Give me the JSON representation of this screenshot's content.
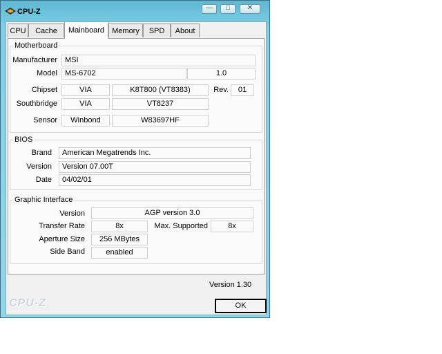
{
  "window": {
    "title": "CPU-Z",
    "minimize_icon": "minimize-icon",
    "maximize_icon": "maximize-icon",
    "close_icon": "close-icon"
  },
  "tabs": [
    {
      "label": "CPU"
    },
    {
      "label": "Cache"
    },
    {
      "label": "Mainboard",
      "active": true
    },
    {
      "label": "Memory"
    },
    {
      "label": "SPD"
    },
    {
      "label": "About"
    }
  ],
  "motherboard": {
    "title": "Motherboard",
    "manufacturer_label": "Manufacturer",
    "manufacturer": "MSI",
    "model_label": "Model",
    "model": "MS-6702",
    "model_rev": "1.0",
    "chipset_label": "Chipset",
    "chipset_vendor": "VIA",
    "chipset_name": "K8T800 (VT8383)",
    "rev_label": "Rev.",
    "rev": "01",
    "southbridge_label": "Southbridge",
    "southbridge_vendor": "VIA",
    "southbridge_name": "VT8237",
    "sensor_label": "Sensor",
    "sensor_vendor": "Winbond",
    "sensor_name": "W83697HF"
  },
  "bios": {
    "title": "BIOS",
    "brand_label": "Brand",
    "brand": "American Megatrends Inc.",
    "version_label": "Version",
    "version": "Version 07.00T",
    "date_label": "Date",
    "date": "04/02/01"
  },
  "graphic": {
    "title": "Graphic Interface",
    "version_label": "Version",
    "version": "AGP version 3.0",
    "transfer_label": "Transfer Rate",
    "transfer": "8x",
    "max_label": "Max. Supported",
    "max": "8x",
    "aperture_label": "Aperture Size",
    "aperture": "256 MBytes",
    "sideband_label": "Side Band",
    "sideband": "enabled"
  },
  "footer": {
    "version": "Version 1.30",
    "logo": "CPU-Z",
    "ok": "OK"
  }
}
